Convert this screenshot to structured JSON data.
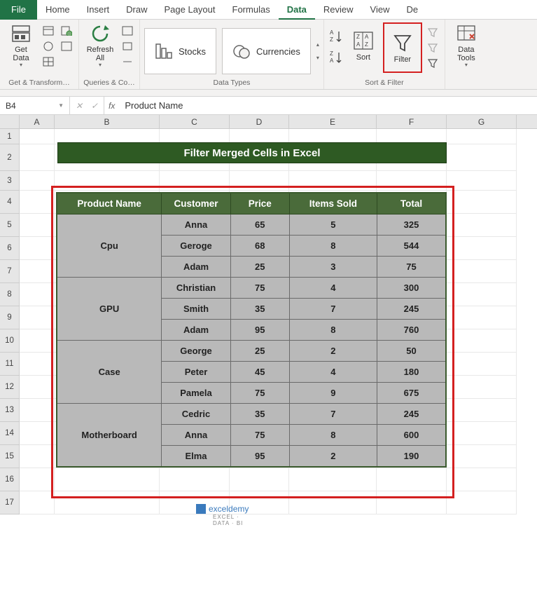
{
  "tabs": {
    "file": "File",
    "home": "Home",
    "insert": "Insert",
    "draw": "Draw",
    "page_layout": "Page Layout",
    "formulas": "Formulas",
    "data": "Data",
    "review": "Review",
    "view": "View",
    "de": "De"
  },
  "ribbon": {
    "get_data": "Get\nData",
    "refresh_all": "Refresh\nAll",
    "stocks": "Stocks",
    "currencies": "Currencies",
    "sort": "Sort",
    "filter": "Filter",
    "data_tools": "Data\nTools",
    "group1": "Get & Transform…",
    "group2": "Queries & Co…",
    "group3": "Data Types",
    "group4": "Sort & Filter"
  },
  "namebox": "B4",
  "formula": "Product Name",
  "columns": [
    "A",
    "B",
    "C",
    "D",
    "E",
    "F",
    "G"
  ],
  "title": "Filter Merged Cells in Excel",
  "chart_data": {
    "type": "table",
    "headers": [
      "Product Name",
      "Customer",
      "Price",
      "Items Sold",
      "Total"
    ],
    "rows": [
      {
        "product": "Cpu",
        "customer": "Anna",
        "price": 65,
        "items": 5,
        "total": 325
      },
      {
        "product": "Cpu",
        "customer": "Geroge",
        "price": 68,
        "items": 8,
        "total": 544
      },
      {
        "product": "Cpu",
        "customer": "Adam",
        "price": 25,
        "items": 3,
        "total": 75
      },
      {
        "product": "GPU",
        "customer": "Christian",
        "price": 75,
        "items": 4,
        "total": 300
      },
      {
        "product": "GPU",
        "customer": "Smith",
        "price": 35,
        "items": 7,
        "total": 245
      },
      {
        "product": "GPU",
        "customer": "Adam",
        "price": 95,
        "items": 8,
        "total": 760
      },
      {
        "product": "Case",
        "customer": "George",
        "price": 25,
        "items": 2,
        "total": 50
      },
      {
        "product": "Case",
        "customer": "Peter",
        "price": 45,
        "items": 4,
        "total": 180
      },
      {
        "product": "Case",
        "customer": "Pamela",
        "price": 75,
        "items": 9,
        "total": 675
      },
      {
        "product": "Motherboard",
        "customer": "Cedric",
        "price": 35,
        "items": 7,
        "total": 245
      },
      {
        "product": "Motherboard",
        "customer": "Anna",
        "price": 75,
        "items": 8,
        "total": 600
      },
      {
        "product": "Motherboard",
        "customer": "Elma",
        "price": 95,
        "items": 2,
        "total": 190
      }
    ]
  },
  "watermark": {
    "brand": "exceldemy",
    "tag": "EXCEL · DATA · BI"
  }
}
